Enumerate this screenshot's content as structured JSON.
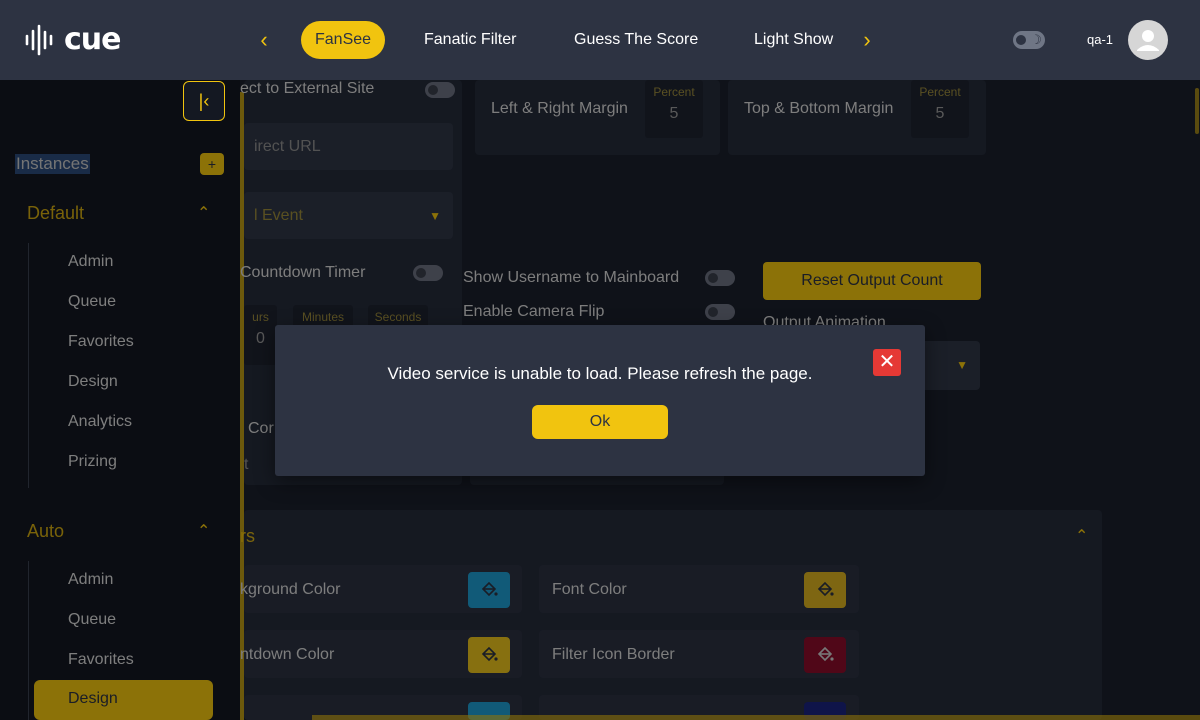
{
  "header": {
    "logo_text": "cue",
    "tabs": [
      {
        "label": "FanSee",
        "active": true
      },
      {
        "label": "Fanatic Filter",
        "active": false
      },
      {
        "label": "Guess The Score",
        "active": false
      },
      {
        "label": "Light Show",
        "active": false
      }
    ],
    "prev_icon": "chevron-left-icon",
    "next_icon": "chevron-right-icon",
    "theme_toggle_icon": "moon-icon",
    "username": "qa-1",
    "avatar_icon": "user-icon"
  },
  "sidebar": {
    "collapse_icon": "collapse-left-icon",
    "instances_label": "Instances",
    "add_label": "+",
    "groups": [
      {
        "title": "Default",
        "items": [
          "Admin",
          "Queue",
          "Favorites",
          "Design",
          "Analytics",
          "Prizing"
        ]
      },
      {
        "title": "Auto",
        "items": [
          "Admin",
          "Queue",
          "Favorites",
          "Design"
        ],
        "active_item": "Design"
      }
    ]
  },
  "main": {
    "redirect_label": "ect to External Site",
    "redirect_url_placeholder": "irect URL",
    "event_select": "l Event",
    "countdown_label": "Countdown Timer",
    "timer_hours": "urs",
    "timer_minutes": "Minutes",
    "timer_seconds": "Seconds",
    "timer_value": "0",
    "cor_label": "Cor",
    "t_label": "t",
    "left_right_margin_label": "Left & Right Margin",
    "top_bottom_margin_label": "Top & Bottom Margin",
    "percent_label": "Percent",
    "left_right_value": "5",
    "top_bottom_value": "5",
    "show_username_label": "Show Username to Mainboard",
    "camera_flip_label": "Enable Camera Flip",
    "reset_button": "Reset Output Count",
    "output_animation_label": "Output Animation",
    "colors_section_title": "rs",
    "color_rows": [
      {
        "label": "kground Color",
        "color": "#1e9ccf"
      },
      {
        "label": "Font Color",
        "color": "#d9b020"
      },
      {
        "label": "ntdown Color",
        "color": "#e8c21c"
      },
      {
        "label": "Filter Icon Border",
        "color": "#8a0d2a"
      },
      {
        "label": "",
        "color": "#1e9ccf"
      },
      {
        "label": "",
        "color": "#1a237e"
      }
    ],
    "paint_icon": "paint-bucket-icon"
  },
  "modal": {
    "message": "Video service is unable to load. Please refresh the page.",
    "ok_label": "Ok",
    "close_icon": "close-icon"
  },
  "colors": {
    "accent": "#f1c40f",
    "header_bg": "#2d3342",
    "sidebar_bg": "#141822",
    "close_red": "#e53935"
  }
}
